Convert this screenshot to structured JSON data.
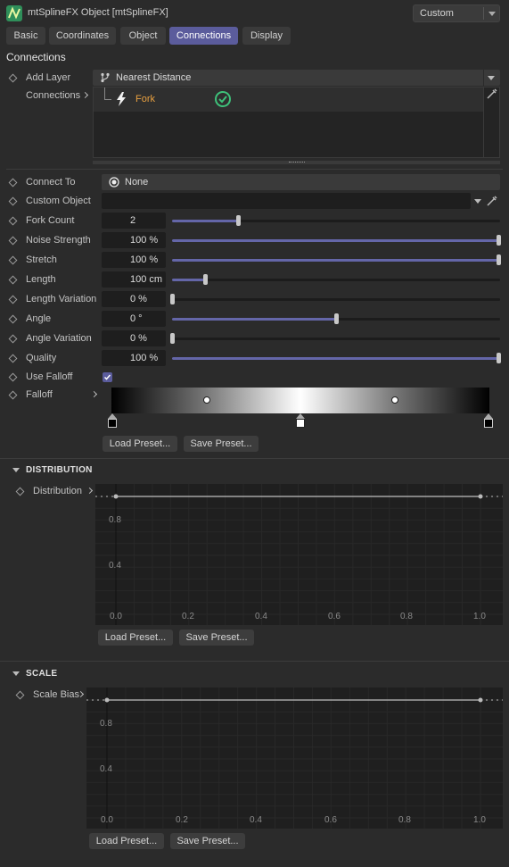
{
  "window": {
    "title": "mtSplineFX Object [mtSplineFX]",
    "layout_dropdown": "Custom"
  },
  "tabs": [
    {
      "label": "Basic"
    },
    {
      "label": "Coordinates"
    },
    {
      "label": "Object"
    },
    {
      "label": "Connections",
      "active": true
    },
    {
      "label": "Display"
    }
  ],
  "connections": {
    "section_title": "Connections",
    "add_layer_label": "Add Layer",
    "add_layer_value": "Nearest Distance",
    "connections_label": "Connections",
    "list_item": {
      "name": "Fork",
      "status": "check-icon"
    },
    "colors": {
      "accent": "#5b5c9c",
      "fork_text": "#e8a040",
      "check": "#3ec27a"
    }
  },
  "params": {
    "connect_to": {
      "label": "Connect To",
      "value": "None"
    },
    "custom_object": {
      "label": "Custom Object",
      "value": ""
    },
    "fork_count": {
      "label": "Fork Count",
      "value": "2",
      "level": 0.2
    },
    "noise_strength": {
      "label": "Noise Strength",
      "value": "100 %",
      "level": 1.0
    },
    "stretch": {
      "label": "Stretch",
      "value": "100 %",
      "level": 1.0
    },
    "length": {
      "label": "Length",
      "value": "100 cm",
      "level": 0.1
    },
    "length_variation": {
      "label": "Length Variation",
      "value": "0 %",
      "level": 0.0
    },
    "angle": {
      "label": "Angle",
      "value": "0 °",
      "level": 0.5
    },
    "angle_variation": {
      "label": "Angle Variation",
      "value": "0 %",
      "level": 0.0
    },
    "quality": {
      "label": "Quality",
      "value": "100 %",
      "level": 1.0
    },
    "use_falloff": {
      "label": "Use Falloff",
      "checked": true
    },
    "falloff": {
      "label": "Falloff"
    },
    "load_preset": "Load Preset...",
    "save_preset": "Save Preset..."
  },
  "distribution": {
    "header": "DISTRIBUTION",
    "label": "Distribution",
    "y_ticks": [
      "0.8",
      "0.4"
    ],
    "x_ticks": [
      "0.0",
      "0.2",
      "0.4",
      "0.6",
      "0.8",
      "1.0"
    ],
    "load_preset": "Load Preset...",
    "save_preset": "Save Preset..."
  },
  "scale": {
    "header": "SCALE",
    "label": "Scale Bias",
    "y_ticks": [
      "0.8",
      "0.4"
    ],
    "x_ticks": [
      "0.0",
      "0.2",
      "0.4",
      "0.6",
      "0.8",
      "1.0"
    ],
    "load_preset": "Load Preset...",
    "save_preset": "Save Preset..."
  }
}
